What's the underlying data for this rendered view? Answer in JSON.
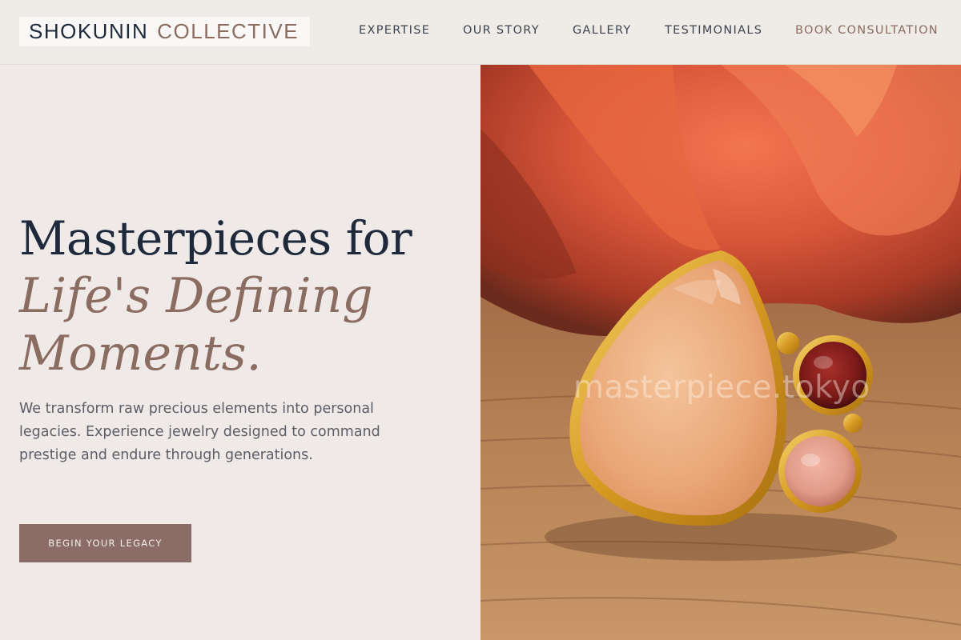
{
  "brand": {
    "name_primary": "SHOKUNIN",
    "name_secondary": "COLLECTIVE",
    "colors": {
      "navy": "#1e2a3b",
      "accent": "#8b6c61",
      "background": "#efe9e8"
    }
  },
  "nav": {
    "items": [
      {
        "label": "EXPERTISE"
      },
      {
        "label": "OUR STORY"
      },
      {
        "label": "GALLERY"
      },
      {
        "label": "TESTIMONIALS"
      }
    ],
    "cta_label": "BOOK CONSULTATION"
  },
  "hero": {
    "headline_line1": "Masterpieces for",
    "headline_line2": "Life's Defining",
    "headline_line3": "Moments.",
    "description": "We transform raw precious elements into personal legacies. Experience jewelry designed to command prestige and endure through generations.",
    "button_label": "BEGIN YOUR LEGACY",
    "image": {
      "subject": "gold ring with pear-shaped peach cat's eye stone, red garnet and pink quartz cabochons on wooden surface with orange rose behind",
      "watermark": "masterpiece.tokyo"
    }
  }
}
